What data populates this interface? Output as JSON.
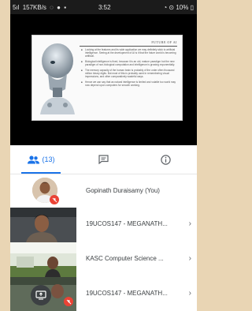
{
  "status_bar": {
    "signal": "5ıl",
    "data_rate": "157KB/s",
    "time": "3:52",
    "battery": "10%"
  },
  "slide": {
    "title": "FUTURE OF AI",
    "bullets": [
      "Looking at the features and its wide application we may definitely stick to artificial intelligence. Seeing at the development of AI is it that the future world is becoming artificial.",
      "Biological intelligence is fixed, because it is an old, mature paradigm but the new paradigm of non-biological computation and intelligence is growing exponentially.",
      "The memory capacity of the human brain is probably of the order often thousand million binary digits. But most of this is probably used in remembering visual impressions, and other comparatively wasteful ways.",
      "Hence we can say that as natural intelligence is limited and volatile too world may now depend upon computers for smooth working."
    ]
  },
  "tabs": {
    "people_count": "(13)"
  },
  "participants": [
    {
      "name": "Gopinath Duraisamy (You)"
    },
    {
      "name": "19UCOS147 - MEGANATH..."
    },
    {
      "name": "KASC Computer Science ..."
    },
    {
      "name": "19UCOS147 - MEGANATH..."
    }
  ],
  "colors": {
    "accent": "#1a73e8",
    "muted_red": "#ea4335"
  },
  "icons": {
    "people_tab": "people-icon",
    "chat_tab": "chat-icon",
    "info_tab": "info-icon",
    "mic_off": "mic-off-icon",
    "present": "present-screen-icon",
    "chevron": "chevron-right-icon"
  }
}
